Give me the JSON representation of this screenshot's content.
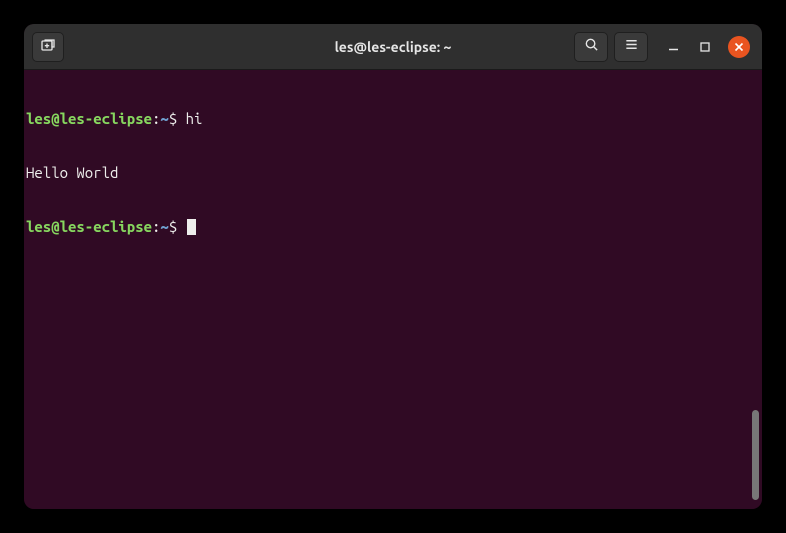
{
  "window": {
    "title": "les@les-eclipse: ~"
  },
  "terminal": {
    "lines": [
      {
        "user": "les@les-eclipse",
        "colon": ":",
        "path": "~",
        "dollar": "$",
        "command": " hi"
      },
      {
        "output": "Hello World"
      },
      {
        "user": "les@les-eclipse",
        "colon": ":",
        "path": "~",
        "dollar": "$",
        "command": " "
      }
    ]
  },
  "colors": {
    "titlebar_bg": "#2f2f2f",
    "terminal_bg": "#300a24",
    "prompt_user": "#87d75f",
    "prompt_path": "#6f9fcf",
    "text": "#eeeeec",
    "close_btn": "#e95420"
  }
}
